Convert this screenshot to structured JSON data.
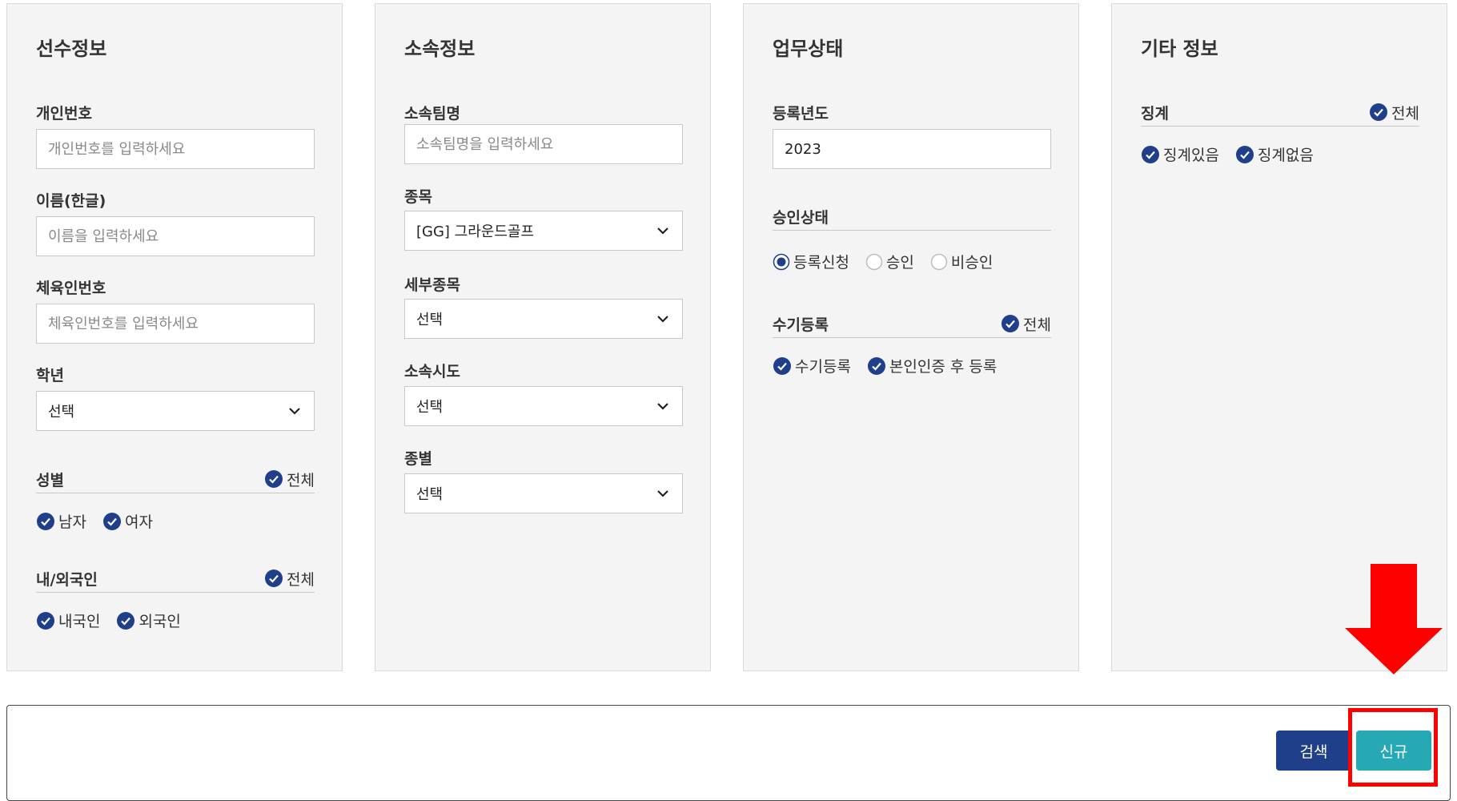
{
  "player_info": {
    "title": "선수정보",
    "personal_no": {
      "label": "개인번호",
      "placeholder": "개인번호를 입력하세요"
    },
    "name_kr": {
      "label": "이름(한글)",
      "placeholder": "이름을 입력하세요"
    },
    "athlete_no": {
      "label": "체육인번호",
      "placeholder": "체육인번호를 입력하세요"
    },
    "grade": {
      "label": "학년",
      "value": "선택"
    },
    "gender": {
      "label": "성별",
      "all": "전체",
      "options": [
        "남자",
        "여자"
      ]
    },
    "nationality": {
      "label": "내/외국인",
      "all": "전체",
      "options": [
        "내국인",
        "외국인"
      ]
    }
  },
  "affiliation": {
    "title": "소속정보",
    "team": {
      "label": "소속팀명",
      "placeholder": "소속팀명을 입력하세요"
    },
    "sport": {
      "label": "종목",
      "value": "[GG] 그라운드골프"
    },
    "sub_sport": {
      "label": "세부종목",
      "value": "선택"
    },
    "region": {
      "label": "소속시도",
      "value": "선택"
    },
    "category": {
      "label": "종별",
      "value": "선택"
    }
  },
  "work_status": {
    "title": "업무상태",
    "reg_year": {
      "label": "등록년도",
      "value": "2023"
    },
    "approval": {
      "label": "승인상태",
      "options": [
        "등록신청",
        "승인",
        "비승인"
      ],
      "selected": "등록신청"
    },
    "manual": {
      "label": "수기등록",
      "all": "전체",
      "options": [
        "수기등록",
        "본인인증 후 등록"
      ]
    }
  },
  "other_info": {
    "title": "기타 정보",
    "discipline": {
      "label": "징계",
      "all": "전체",
      "options": [
        "징계있음",
        "징계없음"
      ]
    }
  },
  "actions": {
    "search": "검색",
    "new": "신규"
  },
  "colors": {
    "check": "#1f3f8a",
    "search_button": "#1f3f8a",
    "new_button": "#26a9b4",
    "annotation": "#ff0000"
  }
}
